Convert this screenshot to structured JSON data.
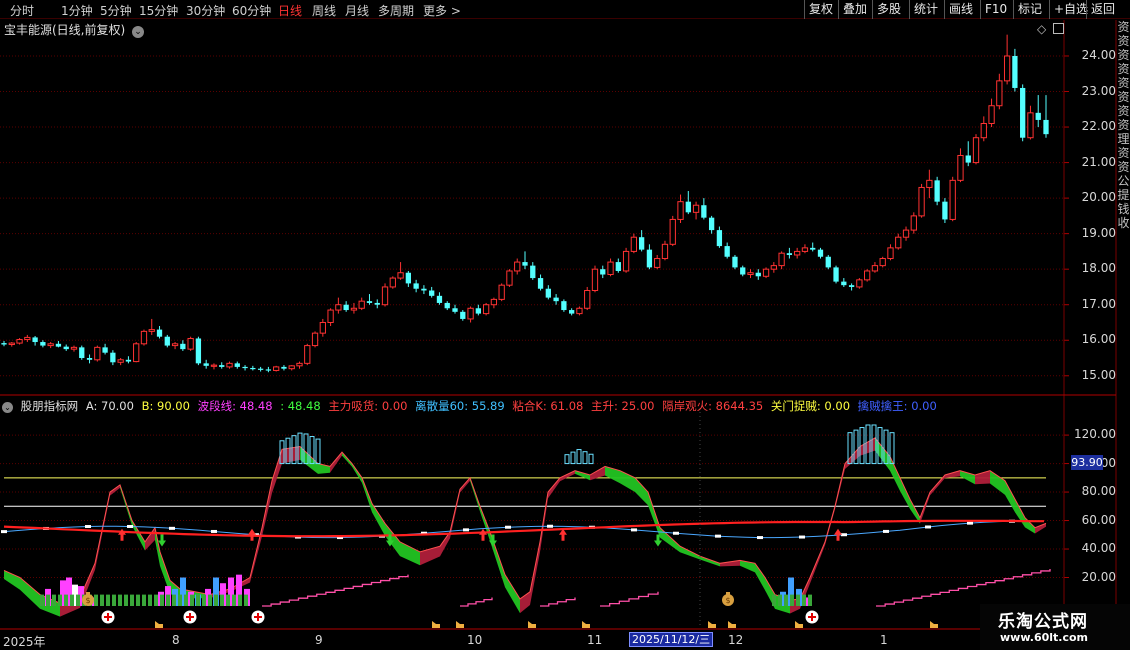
{
  "toolbar": {
    "timeframes": [
      "分时",
      "1分钟",
      "5分钟",
      "15分钟",
      "30分钟",
      "60分钟",
      "日线",
      "周线",
      "月线",
      "多周期",
      "更多 >"
    ],
    "active_timeframe": "日线",
    "buttons": [
      "复权",
      "叠加",
      "多股",
      "统计",
      "画线",
      "F10",
      "标记",
      "+自选",
      "返回"
    ]
  },
  "main_chart": {
    "title": "宝丰能源(日线,前复权)",
    "y_ticks": [
      "24.00",
      "23.00",
      "22.00",
      "21.00",
      "20.00",
      "19.00",
      "18.00",
      "17.00",
      "16.00",
      "15.00"
    ],
    "side_text": [
      "资",
      "资",
      "资",
      "资",
      "资",
      "资",
      "资",
      "资",
      "理",
      "资",
      "资",
      "公",
      "提",
      "钱",
      "收"
    ]
  },
  "indicator": {
    "header": [
      {
        "text": "股朋指标网",
        "color": "#e0e0e0"
      },
      {
        "text": "A: 70.00",
        "color": "#e0e0e0"
      },
      {
        "text": "B: 90.00",
        "color": "#ffff40"
      },
      {
        "text": "波段线: 48.48",
        "color": "#ff40ff"
      },
      {
        "text": ": 48.48",
        "color": "#40ff40"
      },
      {
        "text": "主力吸货: 0.00",
        "color": "#ff4040"
      },
      {
        "text": "离散量60: 55.89",
        "color": "#40c0ff"
      },
      {
        "text": "粘合K: 61.08",
        "color": "#ff4040"
      },
      {
        "text": "主升: 25.00",
        "color": "#ff4040"
      },
      {
        "text": "隔岸观火: 8644.35",
        "color": "#ff4040"
      },
      {
        "text": "关门捉贼: 0.00",
        "color": "#ffff40"
      },
      {
        "text": "擒贼擒王: 0.00",
        "color": "#4060ff"
      }
    ],
    "y_ticks": [
      "120.00",
      "100.00",
      "80.00",
      "60.00",
      "40.00",
      "20.00"
    ],
    "line_A": 70,
    "line_B": 90,
    "current_value": "93.90"
  },
  "x_axis": {
    "labels": [
      "2025年",
      "8",
      "9",
      "10",
      "11",
      "12",
      "1"
    ],
    "cursor_date": "2025/11/12/三"
  },
  "watermark": {
    "title": "乐淘公式网",
    "url": "www.60lt.com"
  },
  "colors": {
    "up_candle": "#ff3232",
    "down_candle": "#54ffff",
    "grid": "#5a0000",
    "line_A": "#ffffff",
    "line_B": "#ffff60",
    "red_ma": "#ff2020",
    "blue_line": "#4aa8ff"
  },
  "chart_data": {
    "type": "candlestick",
    "ylim": [
      14.6,
      24.9
    ],
    "ohlc": [
      [
        15.92,
        15.98,
        15.83,
        15.88
      ],
      [
        15.88,
        15.95,
        15.82,
        15.92
      ],
      [
        15.92,
        16.06,
        15.88,
        16.02
      ],
      [
        16.02,
        16.15,
        15.95,
        16.08
      ],
      [
        16.08,
        16.12,
        15.85,
        15.95
      ],
      [
        15.95,
        16.0,
        15.8,
        15.85
      ],
      [
        15.85,
        15.95,
        15.78,
        15.9
      ],
      [
        15.9,
        15.98,
        15.8,
        15.82
      ],
      [
        15.82,
        15.88,
        15.7,
        15.75
      ],
      [
        15.75,
        15.85,
        15.68,
        15.8
      ],
      [
        15.8,
        15.85,
        15.45,
        15.5
      ],
      [
        15.5,
        15.6,
        15.35,
        15.45
      ],
      [
        15.45,
        15.85,
        15.4,
        15.8
      ],
      [
        15.8,
        15.9,
        15.6,
        15.65
      ],
      [
        15.65,
        15.72,
        15.3,
        15.38
      ],
      [
        15.38,
        15.5,
        15.3,
        15.45
      ],
      [
        15.45,
        15.55,
        15.35,
        15.4
      ],
      [
        15.4,
        15.95,
        15.38,
        15.9
      ],
      [
        15.9,
        16.3,
        15.85,
        16.25
      ],
      [
        16.25,
        16.6,
        16.15,
        16.3
      ],
      [
        16.3,
        16.4,
        16.05,
        16.1
      ],
      [
        16.1,
        16.15,
        15.8,
        15.85
      ],
      [
        15.85,
        15.95,
        15.75,
        15.9
      ],
      [
        15.9,
        16.0,
        15.7,
        15.75
      ],
      [
        15.75,
        16.1,
        15.7,
        16.05
      ],
      [
        16.05,
        16.1,
        15.3,
        15.35
      ],
      [
        15.35,
        15.45,
        15.2,
        15.28
      ],
      [
        15.28,
        15.35,
        15.18,
        15.3
      ],
      [
        15.3,
        15.38,
        15.2,
        15.25
      ],
      [
        15.25,
        15.4,
        15.2,
        15.35
      ],
      [
        15.35,
        15.4,
        15.2,
        15.25
      ],
      [
        15.25,
        15.3,
        15.15,
        15.22
      ],
      [
        15.22,
        15.28,
        15.15,
        15.2
      ],
      [
        15.2,
        15.25,
        15.12,
        15.18
      ],
      [
        15.18,
        15.25,
        15.1,
        15.15
      ],
      [
        15.15,
        15.28,
        15.12,
        15.25
      ],
      [
        15.25,
        15.3,
        15.15,
        15.2
      ],
      [
        15.2,
        15.3,
        15.15,
        15.28
      ],
      [
        15.28,
        15.4,
        15.2,
        15.35
      ],
      [
        15.35,
        15.9,
        15.3,
        15.85
      ],
      [
        15.85,
        16.25,
        15.8,
        16.2
      ],
      [
        16.2,
        16.6,
        16.1,
        16.5
      ],
      [
        16.5,
        16.9,
        16.4,
        16.85
      ],
      [
        16.85,
        17.2,
        16.75,
        17.0
      ],
      [
        17.0,
        17.1,
        16.8,
        16.85
      ],
      [
        16.85,
        17.05,
        16.75,
        16.9
      ],
      [
        16.9,
        17.2,
        16.85,
        17.1
      ],
      [
        17.1,
        17.3,
        17.0,
        17.05
      ],
      [
        17.05,
        17.15,
        16.9,
        17.0
      ],
      [
        17.0,
        17.6,
        16.95,
        17.5
      ],
      [
        17.5,
        17.8,
        17.45,
        17.75
      ],
      [
        17.75,
        18.2,
        17.7,
        17.9
      ],
      [
        17.9,
        17.95,
        17.5,
        17.6
      ],
      [
        17.6,
        17.7,
        17.35,
        17.45
      ],
      [
        17.45,
        17.55,
        17.3,
        17.4
      ],
      [
        17.4,
        17.5,
        17.2,
        17.25
      ],
      [
        17.25,
        17.35,
        17.0,
        17.05
      ],
      [
        17.05,
        17.1,
        16.85,
        16.9
      ],
      [
        16.9,
        17.0,
        16.75,
        16.8
      ],
      [
        16.8,
        16.85,
        16.55,
        16.6
      ],
      [
        16.6,
        16.95,
        16.5,
        16.9
      ],
      [
        16.9,
        17.0,
        16.7,
        16.75
      ],
      [
        16.75,
        17.05,
        16.7,
        17.0
      ],
      [
        17.0,
        17.2,
        16.9,
        17.15
      ],
      [
        17.15,
        17.6,
        17.1,
        17.55
      ],
      [
        17.55,
        18.0,
        17.5,
        17.95
      ],
      [
        17.95,
        18.3,
        17.85,
        18.2
      ],
      [
        18.2,
        18.5,
        18.0,
        18.1
      ],
      [
        18.1,
        18.2,
        17.7,
        17.75
      ],
      [
        17.75,
        17.85,
        17.4,
        17.45
      ],
      [
        17.45,
        17.55,
        17.15,
        17.2
      ],
      [
        17.2,
        17.3,
        17.0,
        17.1
      ],
      [
        17.1,
        17.15,
        16.8,
        16.85
      ],
      [
        16.85,
        16.9,
        16.7,
        16.75
      ],
      [
        16.75,
        16.95,
        16.7,
        16.9
      ],
      [
        16.9,
        17.5,
        16.85,
        17.4
      ],
      [
        17.4,
        18.1,
        17.35,
        18.0
      ],
      [
        18.0,
        18.1,
        17.75,
        17.85
      ],
      [
        17.85,
        18.3,
        17.8,
        18.2
      ],
      [
        18.2,
        18.3,
        17.9,
        17.95
      ],
      [
        17.95,
        18.6,
        17.9,
        18.5
      ],
      [
        18.5,
        19.0,
        18.45,
        18.9
      ],
      [
        18.9,
        19.1,
        18.5,
        18.55
      ],
      [
        18.55,
        18.7,
        18.0,
        18.05
      ],
      [
        18.05,
        18.4,
        18.0,
        18.3
      ],
      [
        18.3,
        18.8,
        18.25,
        18.7
      ],
      [
        18.7,
        19.5,
        18.65,
        19.4
      ],
      [
        19.4,
        20.1,
        19.3,
        19.9
      ],
      [
        19.9,
        20.2,
        19.55,
        19.6
      ],
      [
        19.6,
        19.9,
        19.4,
        19.8
      ],
      [
        19.8,
        20.0,
        19.4,
        19.45
      ],
      [
        19.45,
        19.5,
        19.0,
        19.1
      ],
      [
        19.1,
        19.2,
        18.6,
        18.65
      ],
      [
        18.65,
        18.75,
        18.3,
        18.35
      ],
      [
        18.35,
        18.4,
        18.0,
        18.05
      ],
      [
        18.05,
        18.1,
        17.8,
        17.85
      ],
      [
        17.85,
        18.0,
        17.75,
        17.9
      ],
      [
        17.9,
        18.0,
        17.7,
        17.8
      ],
      [
        17.8,
        18.05,
        17.75,
        18.0
      ],
      [
        18.0,
        18.2,
        17.9,
        18.1
      ],
      [
        18.1,
        18.5,
        18.0,
        18.45
      ],
      [
        18.45,
        18.6,
        18.3,
        18.4
      ],
      [
        18.4,
        18.6,
        18.3,
        18.5
      ],
      [
        18.5,
        18.7,
        18.45,
        18.6
      ],
      [
        18.6,
        18.75,
        18.5,
        18.55
      ],
      [
        18.55,
        18.6,
        18.3,
        18.35
      ],
      [
        18.35,
        18.4,
        18.0,
        18.05
      ],
      [
        18.05,
        18.1,
        17.6,
        17.65
      ],
      [
        17.65,
        17.75,
        17.5,
        17.55
      ],
      [
        17.55,
        17.6,
        17.4,
        17.5
      ],
      [
        17.5,
        17.75,
        17.45,
        17.7
      ],
      [
        17.7,
        18.0,
        17.65,
        17.95
      ],
      [
        17.95,
        18.2,
        17.9,
        18.1
      ],
      [
        18.1,
        18.35,
        18.05,
        18.3
      ],
      [
        18.3,
        18.7,
        18.25,
        18.6
      ],
      [
        18.6,
        19.0,
        18.55,
        18.9
      ],
      [
        18.9,
        19.2,
        18.8,
        19.1
      ],
      [
        19.1,
        19.6,
        19.0,
        19.5
      ],
      [
        19.5,
        20.4,
        19.45,
        20.3
      ],
      [
        20.3,
        20.8,
        20.0,
        20.5
      ],
      [
        20.5,
        20.6,
        19.8,
        19.9
      ],
      [
        19.9,
        20.0,
        19.3,
        19.4
      ],
      [
        19.4,
        20.6,
        19.35,
        20.5
      ],
      [
        20.5,
        21.4,
        20.45,
        21.2
      ],
      [
        21.2,
        21.6,
        20.9,
        21.0
      ],
      [
        21.0,
        21.8,
        20.95,
        21.7
      ],
      [
        21.7,
        22.3,
        21.6,
        22.1
      ],
      [
        22.1,
        22.8,
        22.0,
        22.6
      ],
      [
        22.6,
        23.5,
        22.5,
        23.3
      ],
      [
        23.3,
        24.6,
        23.2,
        24.0
      ],
      [
        24.0,
        24.2,
        23.0,
        23.1
      ],
      [
        23.1,
        23.2,
        21.6,
        21.7
      ],
      [
        21.7,
        22.6,
        21.65,
        22.4
      ],
      [
        22.4,
        22.9,
        22.0,
        22.2
      ],
      [
        22.2,
        22.9,
        21.7,
        21.8
      ]
    ]
  }
}
